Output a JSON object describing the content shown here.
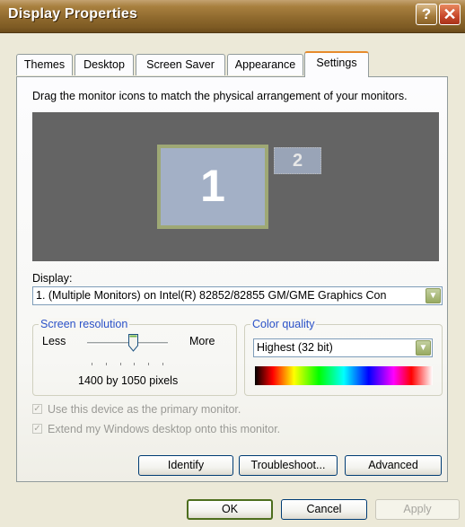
{
  "window": {
    "title": "Display Properties"
  },
  "titlebar": {
    "help_glyph": "?",
    "close_glyph": "✕"
  },
  "tabs": [
    {
      "label": "Themes"
    },
    {
      "label": "Desktop"
    },
    {
      "label": "Screen Saver"
    },
    {
      "label": "Appearance"
    },
    {
      "label": "Settings",
      "active": true
    }
  ],
  "settings": {
    "instruction": "Drag the monitor icons to match the physical arrangement of your monitors.",
    "monitors": [
      {
        "label": "1"
      },
      {
        "label": "2"
      }
    ],
    "display_label": "Display:",
    "display_value": "1. (Multiple Monitors) on Intel(R) 82852/82855 GM/GME Graphics Con",
    "resolution": {
      "group_label": "Screen resolution",
      "less": "Less",
      "more": "More",
      "value": "1400 by 1050 pixels"
    },
    "color_quality": {
      "group_label": "Color quality",
      "value": "Highest (32 bit)"
    },
    "primary_checkbox": "Use this device as the primary monitor.",
    "extend_checkbox": "Extend my Windows desktop onto this monitor.",
    "buttons": {
      "identify": "Identify",
      "troubleshoot": "Troubleshoot...",
      "advanced": "Advanced"
    }
  },
  "footer": {
    "ok": "OK",
    "cancel": "Cancel",
    "apply": "Apply"
  },
  "colors": {
    "titlebar": "#8f6a2e",
    "monitor_bg": "#646464",
    "monitor_face": "#a3b0c6",
    "group_label": "#2b52c8"
  }
}
